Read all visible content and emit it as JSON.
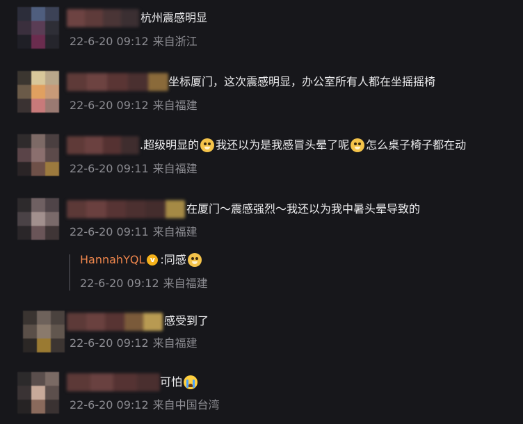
{
  "comments": [
    {
      "text": "杭州震感明显",
      "date": "22-6-20 09:12",
      "location": "来自浙江"
    },
    {
      "text": "坐标厦门，这次震感明显，办公室所有人都在坐摇摇椅",
      "date": "22-6-20 09:12",
      "location": "来自福建"
    },
    {
      "text_a": ".超级明显的",
      "text_b": "我还以为是我感冒头晕了呢",
      "text_c": "怎么桌子椅子都在动",
      "date": "22-6-20 09:11",
      "location": "来自福建"
    },
    {
      "text": "在厦门～震感强烈～我还以为我中暑头晕导致的",
      "date": "22-6-20 09:11",
      "location": "来自福建",
      "reply": {
        "name": "HannahYQL",
        "text": ":同感",
        "date": "22-6-20 09:12",
        "location": "来自福建",
        "badge": "v"
      }
    },
    {
      "text": "感受到了",
      "date": "22-6-20 09:12",
      "location": "来自福建"
    },
    {
      "text": "可怕",
      "date": "22-6-20 09:12",
      "location": "来自中国台湾"
    }
  ],
  "colors": {
    "background": "#17171b",
    "meta": "#8c8c92",
    "reply_name": "#f0874d",
    "verified": "#f5b21b"
  },
  "icons": [
    "dog-emoji-icon",
    "crying-emoji-icon",
    "verified-badge-icon"
  ]
}
